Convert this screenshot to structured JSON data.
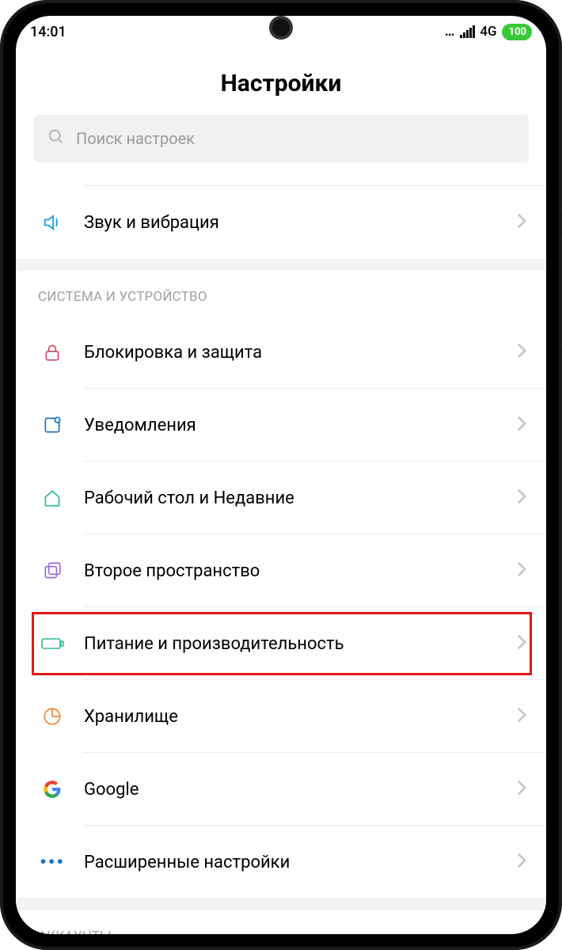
{
  "status": {
    "time": "14:01",
    "network": "4G",
    "battery": "100"
  },
  "header": {
    "title": "Настройки"
  },
  "search": {
    "placeholder": "Поиск настроек"
  },
  "sections": {
    "top_items": {
      "sound": {
        "label": "Звук и вибрация"
      }
    },
    "system": {
      "header": "СИСТЕМА И УСТРОЙСТВО",
      "lock": {
        "label": "Блокировка и защита"
      },
      "notifications": {
        "label": "Уведомления"
      },
      "home": {
        "label": "Рабочий стол и Недавние"
      },
      "second_space": {
        "label": "Второе пространство"
      },
      "battery": {
        "label": "Питание и производительность"
      },
      "storage": {
        "label": "Хранилище"
      },
      "google": {
        "label": "Google"
      },
      "advanced": {
        "label": "Расширенные настройки"
      }
    },
    "accounts": {
      "header": "АККАУНТЫ"
    }
  },
  "highlighted_item": "battery"
}
